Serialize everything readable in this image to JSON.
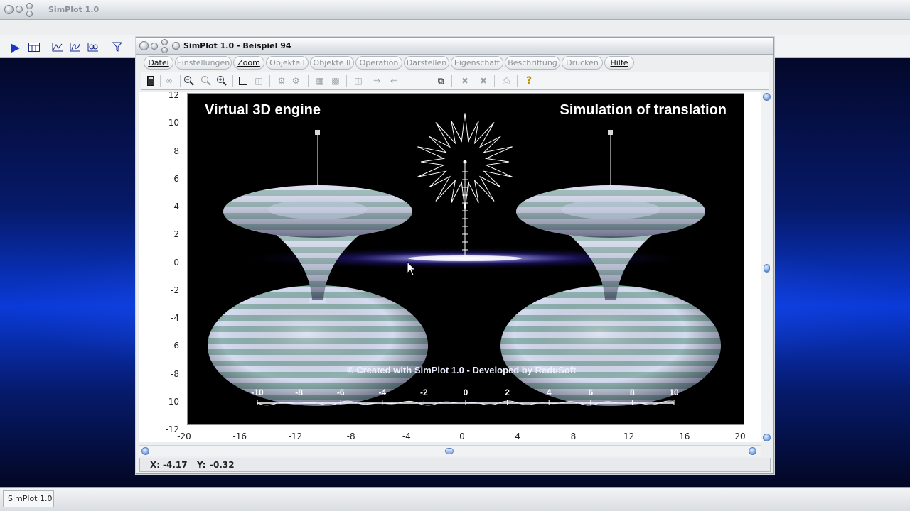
{
  "app": {
    "title": "SimPlot 1.0",
    "taskbar_label": "SimPlot 1.0"
  },
  "window": {
    "title": "SimPlot 1.0 - Beispiel 94"
  },
  "menu": [
    {
      "label": "Datei",
      "enabled": true
    },
    {
      "label": "Einstellungen",
      "enabled": false
    },
    {
      "label": "Zoom",
      "enabled": true
    },
    {
      "label": "Objekte I",
      "enabled": false
    },
    {
      "label": "Objekte II",
      "enabled": false
    },
    {
      "label": "Operation",
      "enabled": false
    },
    {
      "label": "Darstellen",
      "enabled": false
    },
    {
      "label": "Eigenschaft",
      "enabled": false
    },
    {
      "label": "Beschriftung",
      "enabled": false
    },
    {
      "label": "Drucken",
      "enabled": false
    },
    {
      "label": "Hilfe",
      "enabled": true
    }
  ],
  "plot": {
    "y_ticks": [
      "12",
      "10",
      "8",
      "6",
      "4",
      "2",
      "0",
      "-2",
      "-4",
      "-6",
      "-8",
      "-10",
      "-12"
    ],
    "x_ticks": [
      "-20",
      "-16",
      "-12",
      "-8",
      "-4",
      "0",
      "4",
      "8",
      "12",
      "16",
      "20"
    ],
    "left_heading": "Virtual 3D engine",
    "right_heading": "Simulation of translation",
    "credit": "© Created with SimPlot 1.0 - Developed by ReduSoft",
    "inner_ticks": [
      "-10",
      "-8",
      "-6",
      "-4",
      "-2",
      "0",
      "2",
      "4",
      "6",
      "8",
      "10"
    ]
  },
  "status": {
    "x_label": "X:",
    "x_value": "-4.17",
    "y_label": "Y:",
    "y_value": "-0.32"
  },
  "colors": {
    "desktop_blue": "#0a3ad8",
    "surface_stripe_light": "#d6dcf0",
    "surface_stripe_teal": "#8fb2b0"
  }
}
